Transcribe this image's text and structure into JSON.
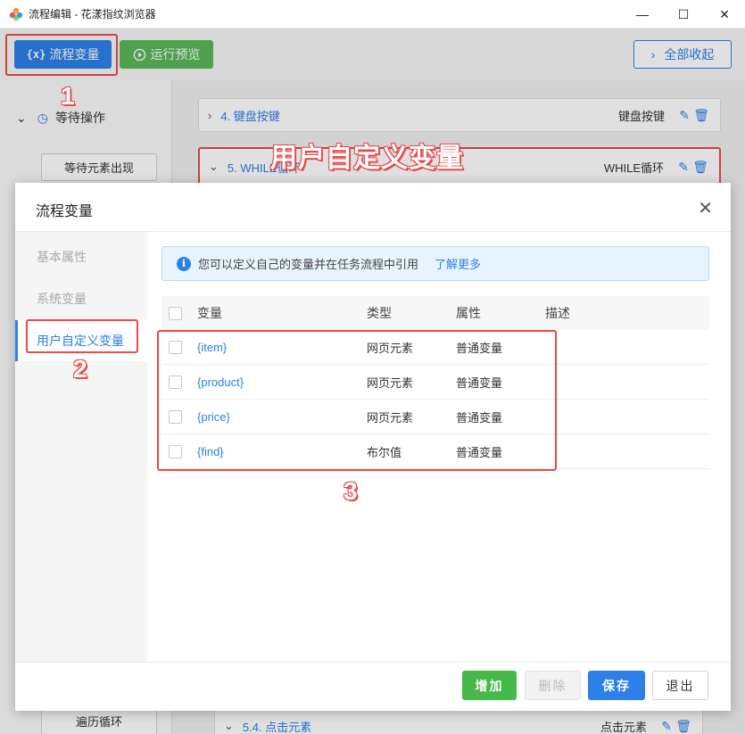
{
  "window": {
    "title": "流程编辑 - 花漾指纹浏览器",
    "minimize": "—",
    "maximize": "☐",
    "close": "✕"
  },
  "toolbar": {
    "flow_var_icon": "{x}",
    "flow_var_label": "流程变量",
    "run_preview_label": "运行预览",
    "collapse_all_label": "全部收起"
  },
  "left_panel": {
    "wait_section": "等待操作",
    "wait_element_btn": "等待元素出现",
    "loop_btn": "遍历循环"
  },
  "flow": {
    "cards": [
      {
        "name": "4. 键盘按键",
        "type": "键盘按键"
      },
      {
        "name": "5. WHILE循环",
        "type": "WHILE循环"
      },
      {
        "name": "5.4. 点击元素",
        "type": "点击元素"
      }
    ]
  },
  "annotations": {
    "title": "用户自定义变量",
    "n1": "1",
    "n2": "2",
    "n3": "3",
    "color": "#e94a4a"
  },
  "modal": {
    "title": "流程变量",
    "nav": [
      "基本属性",
      "系统变量",
      "用户自定义变量"
    ],
    "active_nav": "用户自定义变量",
    "info_text": "您可以定义自己的变量并在任务流程中引用",
    "info_link": "了解更多",
    "columns": {
      "var": "变量",
      "type": "类型",
      "attr": "属性",
      "desc": "描述"
    },
    "rows": [
      {
        "var": "{item}",
        "type": "网页元素",
        "attr": "普通变量"
      },
      {
        "var": "{product}",
        "type": "网页元素",
        "attr": "普通变量"
      },
      {
        "var": "{price}",
        "type": "网页元素",
        "attr": "普通变量"
      },
      {
        "var": "{find}",
        "type": "布尔值",
        "attr": "普通变量"
      }
    ],
    "buttons": {
      "add": "增加",
      "delete": "删除",
      "save": "保存",
      "exit": "退出"
    }
  },
  "colors": {
    "primary": "#2d80e8",
    "success": "#47b84a",
    "annotation": "#e94a4a"
  }
}
